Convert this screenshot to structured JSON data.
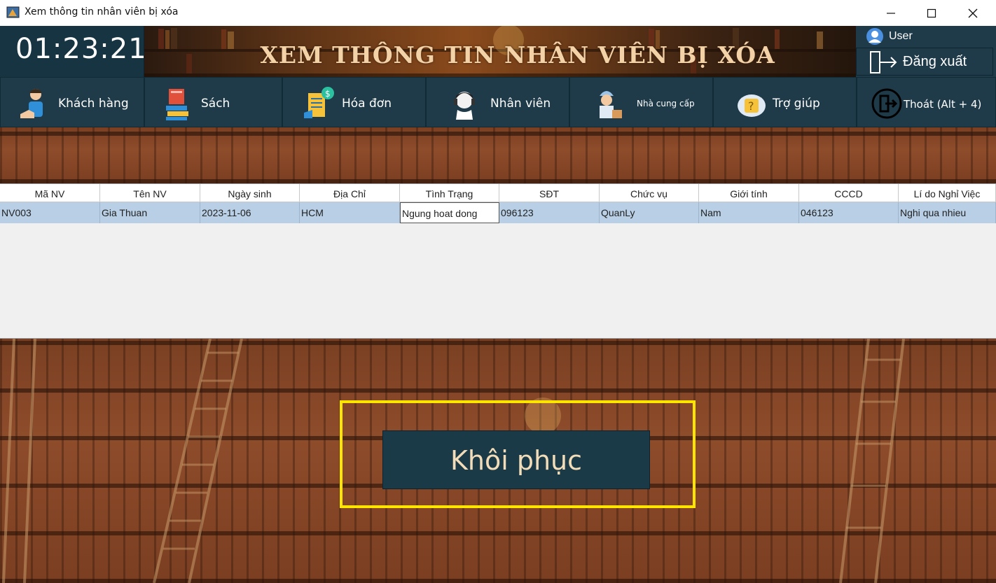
{
  "window": {
    "title": "Xem thông tin nhân viên bị xóa"
  },
  "header": {
    "clock": "01:23:21",
    "banner_title": "XEM THÔNG TIN NHÂN VIÊN BỊ XÓA",
    "user_label": "User",
    "logout_label": "Đăng xuất"
  },
  "menu": [
    {
      "label": "Khách hàng",
      "icon": "customer-icon"
    },
    {
      "label": "Sách",
      "icon": "books-icon"
    },
    {
      "label": "Hóa đơn",
      "icon": "invoice-icon"
    },
    {
      "label": "Nhân viên",
      "icon": "employee-icon"
    },
    {
      "label": "Nhà cung cấp",
      "icon": "supplier-icon"
    },
    {
      "label": "Trợ giúp",
      "icon": "help-icon"
    },
    {
      "label": "Thoát (Alt + 4)",
      "icon": "exit-icon"
    }
  ],
  "table": {
    "columns": [
      "Mã NV",
      "Tên NV",
      "Ngày sinh",
      "Địa Chỉ",
      "Tình Trạng",
      "SĐT",
      "Chức vụ",
      "Giới tính",
      "CCCD",
      "Lí do Nghỉ Việc"
    ],
    "rows": [
      [
        "NV003",
        "Gia Thuan",
        "2023-11-06",
        "HCM",
        "Ngung hoat dong",
        "096123",
        "QuanLy",
        "Nam",
        "046123",
        "Nghi qua nhieu"
      ]
    ]
  },
  "actions": {
    "restore_label": "Khôi phục"
  },
  "colors": {
    "navy": "#1f3b4a",
    "highlight": "#ffe500",
    "selected_row": "#b8cfe5"
  }
}
